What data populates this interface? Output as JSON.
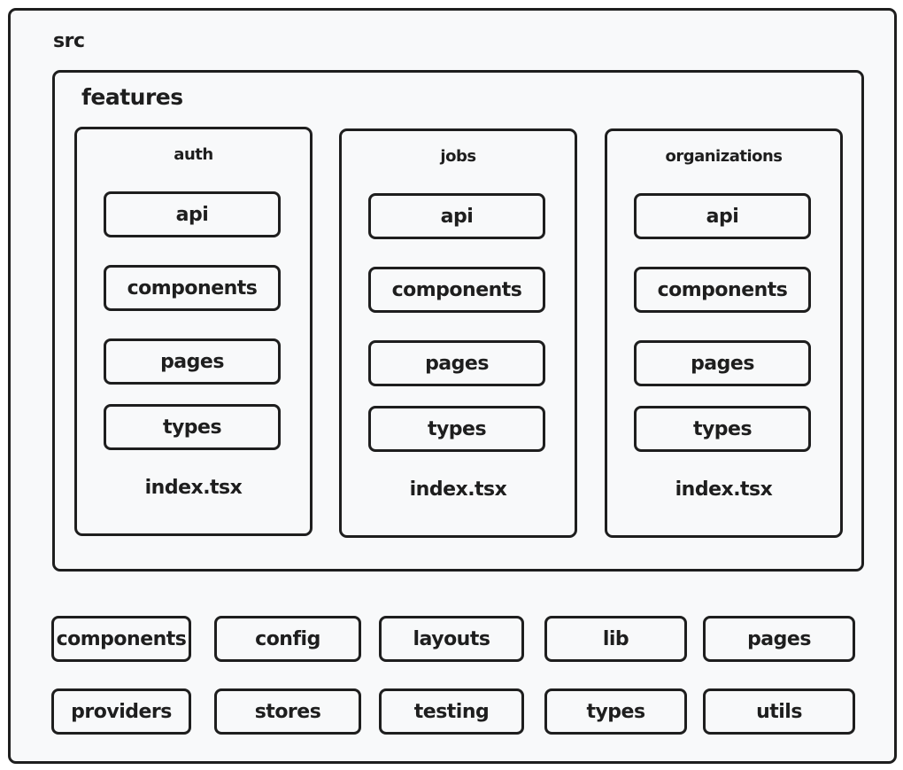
{
  "diagram": {
    "root": {
      "label": "src"
    },
    "features_folder": {
      "label": "features",
      "features": [
        {
          "name": "auth",
          "subfolders": [
            "api",
            "components",
            "pages",
            "types"
          ],
          "index_file": "index.tsx"
        },
        {
          "name": "jobs",
          "subfolders": [
            "api",
            "components",
            "pages",
            "types"
          ],
          "index_file": "index.tsx"
        },
        {
          "name": "organizations",
          "subfolders": [
            "api",
            "components",
            "pages",
            "types"
          ],
          "index_file": "index.tsx"
        }
      ]
    },
    "root_folders": {
      "row1": [
        "components",
        "config",
        "layouts",
        "lib",
        "pages"
      ],
      "row2": [
        "providers",
        "stores",
        "testing",
        "types",
        "utils"
      ]
    },
    "colors": {
      "stroke": "#1e1e1e",
      "fill": "#f8f9fa"
    }
  }
}
